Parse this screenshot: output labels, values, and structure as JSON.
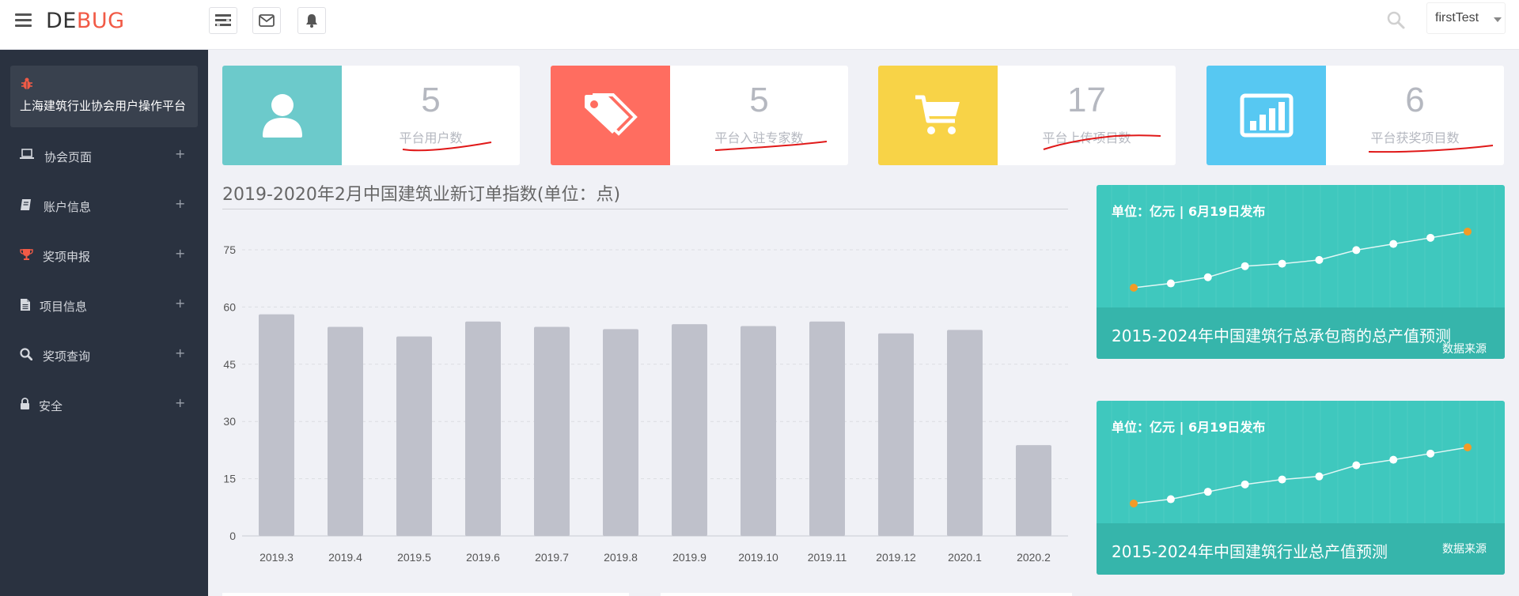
{
  "header": {
    "logo_part1": "DE",
    "logo_part2": "BUG",
    "user_name": "firstTest",
    "icons": [
      "menu-icon",
      "list-icon",
      "mail-icon",
      "bell-icon",
      "search-icon"
    ]
  },
  "sidebar": {
    "brand_name": "上海建筑行业协会用户操作平台",
    "items": [
      {
        "label": "协会页面",
        "icon": "laptop-icon"
      },
      {
        "label": "账户信息",
        "icon": "book-icon"
      },
      {
        "label": "奖项申报",
        "icon": "trophy-icon"
      },
      {
        "label": "项目信息",
        "icon": "file-icon"
      },
      {
        "label": "奖项查询",
        "icon": "search-icon"
      },
      {
        "label": "安全",
        "icon": "lock-icon"
      }
    ],
    "expand_symbol": "+"
  },
  "stats": [
    {
      "value": "5",
      "label": "平台用户数",
      "color": "#6ccacb",
      "icon": "user-icon"
    },
    {
      "value": "5",
      "label": "平台入驻专家数",
      "color": "#ff6d60",
      "icon": "tags-icon"
    },
    {
      "value": "17",
      "label": "平台上传项目数",
      "color": "#f8d347",
      "icon": "cart-icon"
    },
    {
      "value": "6",
      "label": "平台获奖项目数",
      "color": "#57c8f2",
      "icon": "bar-chart-icon"
    }
  ],
  "main_chart_title": "2019-2020年2月中国建筑业新订单指数(单位：点)",
  "chart_data": {
    "type": "bar",
    "title": "2019-2020年2月中国建筑业新订单指数(单位：点)",
    "categories": [
      "2019.3",
      "2019.4",
      "2019.5",
      "2019.6",
      "2019.7",
      "2019.8",
      "2019.9",
      "2019.10",
      "2019.11",
      "2019.12",
      "2020.1",
      "2020.2"
    ],
    "values": [
      58.1,
      54.8,
      52.3,
      56.2,
      54.8,
      54.2,
      55.5,
      55.0,
      56.2,
      53.1,
      54.0,
      23.8
    ],
    "yticks": [
      0,
      15,
      30,
      45,
      60,
      75
    ],
    "ylim": [
      0,
      75
    ],
    "grid": true,
    "bar_color": "#bfc1cb",
    "xlabel": "",
    "ylabel": ""
  },
  "panels": [
    {
      "unit": "单位：亿元 | 6月19日发布",
      "title": "2015-2024年中国建筑行总承包商的总产值预测",
      "source": "数据来源",
      "trend": [
        0,
        0.07,
        0.17,
        0.35,
        0.39,
        0.45,
        0.61,
        0.71,
        0.81,
        0.91
      ]
    },
    {
      "unit": "单位：亿元 | 6月19日发布",
      "title": "2015-2024年中国建筑行业总产值预测",
      "source": "数据来源",
      "trend": [
        0,
        0.07,
        0.19,
        0.31,
        0.39,
        0.44,
        0.62,
        0.71,
        0.81,
        0.91
      ]
    }
  ]
}
